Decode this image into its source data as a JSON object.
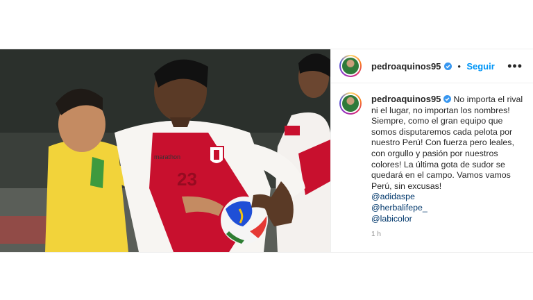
{
  "post": {
    "username": "pedroaquinos95",
    "follow_label": "Seguir",
    "separator": "•",
    "more_label": "•••",
    "caption_user": "pedroaquinos95",
    "caption_text": "No importa el rival ni el lugar, no importan los nombres! Siempre, como el gran equipo que somos disputaremos cada pelota por nuestro Perú! Con fuerza pero leales, con orgullo y pasión por nuestros colores! La última gota de sudor se quedará en el campo. Vamos vamos Perú, sin excusas!",
    "mentions": [
      "@adidaspe",
      "@herbalifepe_",
      "@labicolor"
    ],
    "time": "1 h"
  },
  "photo": {
    "shirt_brand": "marathon",
    "shirt_number": "23"
  },
  "colors": {
    "accent": "#0095f6",
    "verified": "#3897f0",
    "peru_red": "#c8102e",
    "brazil_yellow": "#f2d33a"
  }
}
